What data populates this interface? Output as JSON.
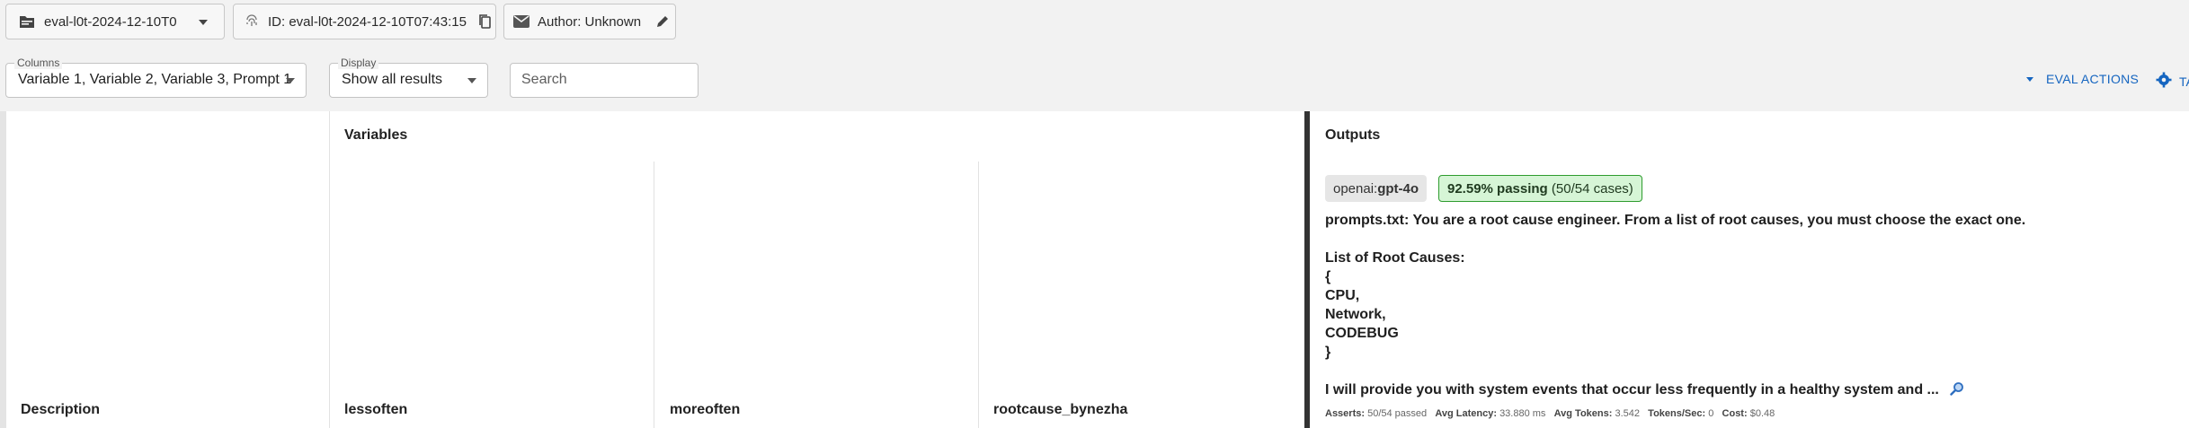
{
  "header": {
    "eval_select": "eval-l0t-2024-12-10T0",
    "id_text": "ID: eval-l0t-2024-12-10T07:43:15",
    "author_text": "Author: Unknown"
  },
  "controls": {
    "columns_label": "Columns",
    "columns_value": "Variable 1, Variable 2, Variable 3, Prompt 1",
    "display_label": "Display",
    "display_value": "Show all results",
    "search_placeholder": "Search",
    "eval_actions_label": "EVAL ACTIONS",
    "tab_label": "TA"
  },
  "table": {
    "variables_header": "Variables",
    "outputs_header": "Outputs",
    "columns": [
      "Description",
      "lessoften",
      "moreoften",
      "rootcause_bynezha"
    ],
    "prompt": {
      "provider_prefix": "openai:",
      "provider_model": "gpt-4o",
      "pass_rate": "92.59% passing",
      "pass_cases": "(50/54 cases)",
      "lines": [
        "prompts.txt: You are a root cause engineer. From a list of root causes, you must choose the exact one.",
        "",
        "List of Root Causes:",
        "{",
        "CPU,",
        "Network,",
        "CODEBUG",
        "}",
        "",
        "I will provide you with system events that occur less frequently in a healthy system and ..."
      ],
      "stats": {
        "asserts_label": "Asserts:",
        "asserts_value": "50/54 passed",
        "latency_label": "Avg Latency:",
        "latency_value": "33.880 ms",
        "tokens_label": "Avg Tokens:",
        "tokens_value": "3.542",
        "tps_label": "Tokens/Sec:",
        "tps_value": "0",
        "cost_label": "Cost:",
        "cost_value": "$0.48"
      }
    }
  },
  "colors": {
    "accent": "#1565c0",
    "pass_bg": "#d6f5d6",
    "pass_border": "#2e9c2e"
  },
  "icons": [
    "folder-icon",
    "fingerprint-icon",
    "copy-icon",
    "email-icon",
    "edit-icon",
    "chevron-down-icon",
    "gear-icon",
    "magnify-icon"
  ]
}
